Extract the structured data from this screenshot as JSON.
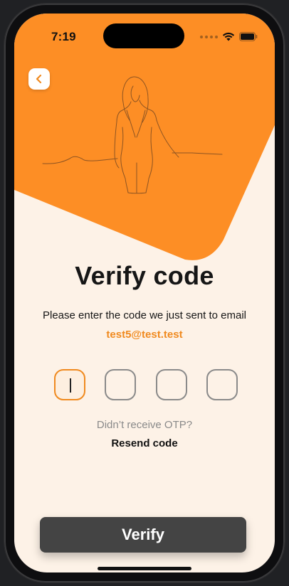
{
  "status_bar": {
    "time": "7:19",
    "icons": [
      "signal-dots-icon",
      "wifi-icon",
      "battery-icon"
    ]
  },
  "nav": {
    "back_icon": "chevron-left-icon"
  },
  "hero": {
    "illustration": "woman-line-art-illustration",
    "background_color": "#fd8e25"
  },
  "verify_screen": {
    "title": "Verify code",
    "subtitle": "Please enter the code we just sent to email",
    "email": "test5@test.test",
    "otp_digits": [
      "",
      "",
      "",
      ""
    ],
    "no_otp_text": "Didn’t receive OTP?",
    "resend_label": "Resend code",
    "verify_label": "Verify"
  },
  "colors": {
    "accent": "#f08a1f",
    "background": "#fdf2e7",
    "button": "#444444"
  }
}
